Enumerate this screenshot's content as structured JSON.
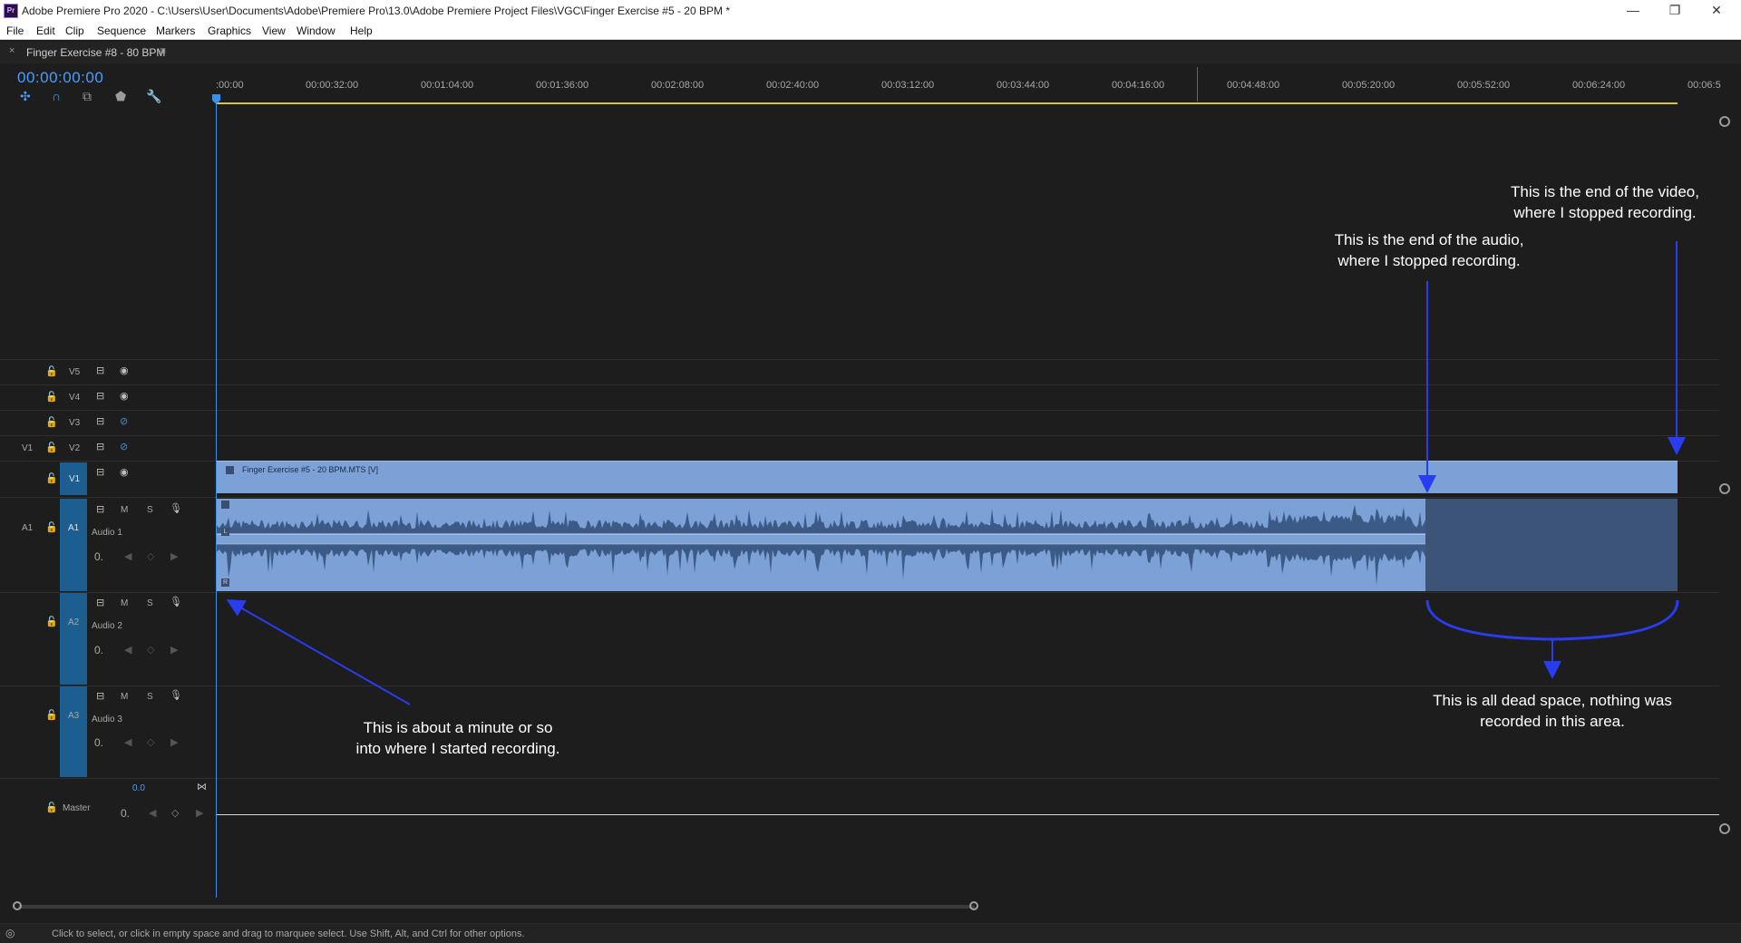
{
  "window": {
    "app_icon_label": "Pr",
    "title": "Adobe Premiere Pro 2020 - C:\\Users\\User\\Documents\\Adobe\\Premiere Pro\\13.0\\Adobe Premiere Project Files\\VGC\\Finger Exercise #5 - 20 BPM *",
    "controls": {
      "minimize": "—",
      "restore": "❐",
      "close": "✕"
    }
  },
  "menu": [
    "File",
    "Edit",
    "Clip",
    "Sequence",
    "Markers",
    "Graphics",
    "View",
    "Window",
    "Help"
  ],
  "panel": {
    "close_glyph": "×",
    "sequence_name": "Finger Exercise #8 - 80 BPM",
    "menu_glyph": "≡"
  },
  "timecode": "00:00:00:00",
  "toolbar_icons": [
    "nest-icon",
    "snap-icon",
    "linked-selection-icon",
    "add-marker-icon",
    "wrench-icon"
  ],
  "ruler": {
    "ticks": [
      ":00:00",
      "00:00:32:00",
      "00:01:04:00",
      "00:01:36:00",
      "00:02:08:00",
      "00:02:40:00",
      "00:03:12:00",
      "00:03:44:00",
      "00:04:16:00",
      "00:04:48:00",
      "00:05:20:00",
      "00:05:52:00",
      "00:06:24:00",
      "00:06:5"
    ]
  },
  "video_tracks": [
    {
      "name": "V5",
      "source": ""
    },
    {
      "name": "V4",
      "source": ""
    },
    {
      "name": "V3",
      "source": ""
    },
    {
      "name": "V2",
      "source": "V1"
    },
    {
      "name": "V1",
      "source": ""
    }
  ],
  "audio_tracks": [
    {
      "name": "A1",
      "source": "A1",
      "label": "Audio 1",
      "m": "M",
      "s": "S",
      "volume": "0."
    },
    {
      "name": "A2",
      "source": "",
      "label": "Audio 2",
      "m": "M",
      "s": "S",
      "volume": "0."
    },
    {
      "name": "A3",
      "source": "",
      "label": "Audio 3",
      "m": "M",
      "s": "S",
      "volume": "0."
    }
  ],
  "master": {
    "value": "0.0",
    "label": "Master",
    "volume": "0."
  },
  "clips": {
    "video_label": "Finger Exercise #5 - 20 BPM.MTS [V]",
    "audio_left_marker": "L",
    "audio_right_marker": "R"
  },
  "annotations": {
    "video_end": "This is the end of the video,\nwhere I stopped recording.",
    "audio_end": "This is the end of the audio,\nwhere I stopped recording.",
    "start": "This is about a minute or so\ninto where I started recording.",
    "dead_space": "This is all dead space, nothing was\nrecorded in this area."
  },
  "status": {
    "text": "Click to select, or click in empty space and drag to marquee select. Use Shift, Alt, and Ctrl for other options."
  },
  "colors": {
    "accent": "#4a9cff",
    "clip": "#7ba1d6",
    "dead_space": "#3b5478",
    "arrow": "#2a3cf0",
    "work_area": "#d8c63a"
  }
}
